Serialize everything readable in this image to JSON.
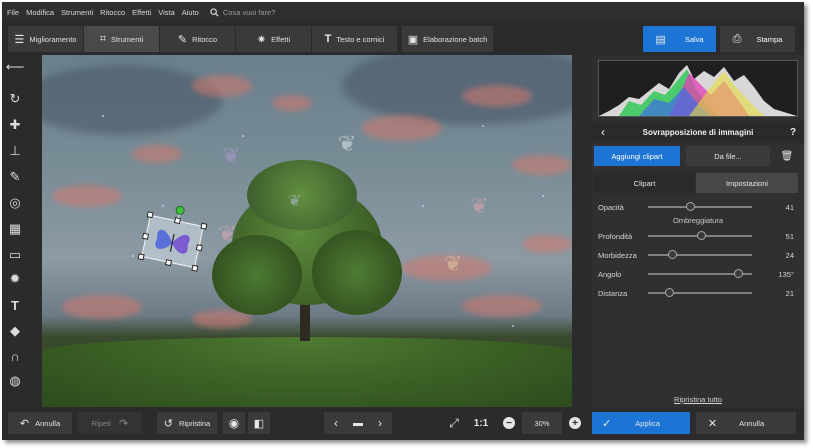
{
  "menu": [
    "File",
    "Modifica",
    "Strumenti",
    "Ritocco",
    "Effetti",
    "Vista",
    "Aiuto"
  ],
  "search": {
    "placeholder": "Cosa vuoi fare?"
  },
  "tabs": [
    {
      "label": "Miglioramento",
      "icon": "sliders-icon"
    },
    {
      "label": "Strumenti",
      "icon": "crop-icon"
    },
    {
      "label": "Ritocco",
      "icon": "brush-icon"
    },
    {
      "label": "Effetti",
      "icon": "magic-wand-icon"
    },
    {
      "label": "Testo e cornici",
      "icon": "text-icon"
    },
    {
      "label": "Elaborazione batch",
      "icon": "batch-icon"
    }
  ],
  "active_tab": "Strumenti",
  "save_label": "Salva",
  "print_label": "Stampa",
  "tools": [
    "back-arrow-icon",
    "rotate-icon",
    "healing-patch-icon",
    "stamp-icon",
    "brush-icon",
    "radial-icon",
    "gradient-icon",
    "vignette-icon",
    "light-icon",
    "text-icon",
    "fill-icon",
    "magnet-icon",
    "globe-icon"
  ],
  "panel": {
    "title": "Sovrapposizione di immagini",
    "help": "?",
    "add_clipart": "Aggiungi clipart",
    "from_file": "Da file...",
    "subtabs": [
      "Clipart",
      "Impostazioni"
    ],
    "active_subtab": "Impostazioni",
    "opacity": {
      "label": "Opacità",
      "value": "41",
      "fraction": 0.41
    },
    "shadow_header": "Ombreggiatura",
    "sliders": [
      {
        "label": "Profondità",
        "value": "51",
        "fraction": 0.51
      },
      {
        "label": "Morbidezza",
        "value": "24",
        "fraction": 0.24
      },
      {
        "label": "Angolo",
        "value": "135°",
        "fraction": 0.87
      },
      {
        "label": "Distanza",
        "value": "21",
        "fraction": 0.21
      }
    ],
    "reset": "Ripristina tutto"
  },
  "bottom": {
    "undo": "Annulla",
    "redo": "Ripeti",
    "restore": "Ripristina",
    "ratio": "1:1",
    "zoom": "30%",
    "apply": "Applica",
    "cancel": "Annulla"
  },
  "colors": {
    "accent": "#1c74d4",
    "rotate_handle": "#3fbf3f"
  }
}
